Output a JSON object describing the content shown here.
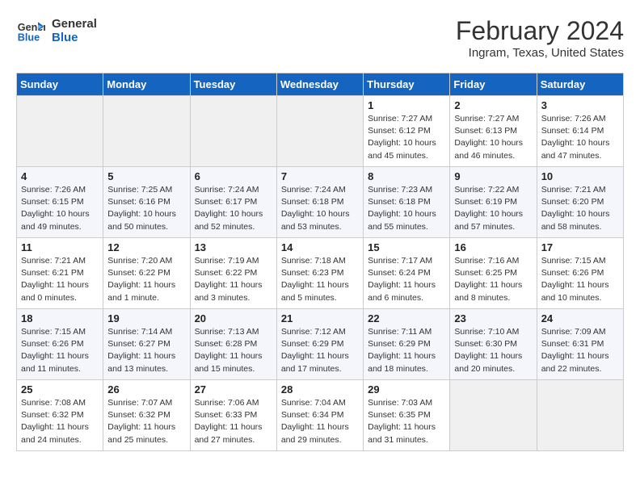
{
  "logo": {
    "line1": "General",
    "line2": "Blue"
  },
  "header": {
    "month": "February 2024",
    "location": "Ingram, Texas, United States"
  },
  "days_of_week": [
    "Sunday",
    "Monday",
    "Tuesday",
    "Wednesday",
    "Thursday",
    "Friday",
    "Saturday"
  ],
  "weeks": [
    [
      {
        "day": "",
        "sunrise": "",
        "sunset": "",
        "daylight": ""
      },
      {
        "day": "",
        "sunrise": "",
        "sunset": "",
        "daylight": ""
      },
      {
        "day": "",
        "sunrise": "",
        "sunset": "",
        "daylight": ""
      },
      {
        "day": "",
        "sunrise": "",
        "sunset": "",
        "daylight": ""
      },
      {
        "day": "1",
        "sunrise": "7:27 AM",
        "sunset": "6:12 PM",
        "daylight": "10 hours and 45 minutes."
      },
      {
        "day": "2",
        "sunrise": "7:27 AM",
        "sunset": "6:13 PM",
        "daylight": "10 hours and 46 minutes."
      },
      {
        "day": "3",
        "sunrise": "7:26 AM",
        "sunset": "6:14 PM",
        "daylight": "10 hours and 47 minutes."
      }
    ],
    [
      {
        "day": "4",
        "sunrise": "7:26 AM",
        "sunset": "6:15 PM",
        "daylight": "10 hours and 49 minutes."
      },
      {
        "day": "5",
        "sunrise": "7:25 AM",
        "sunset": "6:16 PM",
        "daylight": "10 hours and 50 minutes."
      },
      {
        "day": "6",
        "sunrise": "7:24 AM",
        "sunset": "6:17 PM",
        "daylight": "10 hours and 52 minutes."
      },
      {
        "day": "7",
        "sunrise": "7:24 AM",
        "sunset": "6:18 PM",
        "daylight": "10 hours and 53 minutes."
      },
      {
        "day": "8",
        "sunrise": "7:23 AM",
        "sunset": "6:18 PM",
        "daylight": "10 hours and 55 minutes."
      },
      {
        "day": "9",
        "sunrise": "7:22 AM",
        "sunset": "6:19 PM",
        "daylight": "10 hours and 57 minutes."
      },
      {
        "day": "10",
        "sunrise": "7:21 AM",
        "sunset": "6:20 PM",
        "daylight": "10 hours and 58 minutes."
      }
    ],
    [
      {
        "day": "11",
        "sunrise": "7:21 AM",
        "sunset": "6:21 PM",
        "daylight": "11 hours and 0 minutes."
      },
      {
        "day": "12",
        "sunrise": "7:20 AM",
        "sunset": "6:22 PM",
        "daylight": "11 hours and 1 minute."
      },
      {
        "day": "13",
        "sunrise": "7:19 AM",
        "sunset": "6:22 PM",
        "daylight": "11 hours and 3 minutes."
      },
      {
        "day": "14",
        "sunrise": "7:18 AM",
        "sunset": "6:23 PM",
        "daylight": "11 hours and 5 minutes."
      },
      {
        "day": "15",
        "sunrise": "7:17 AM",
        "sunset": "6:24 PM",
        "daylight": "11 hours and 6 minutes."
      },
      {
        "day": "16",
        "sunrise": "7:16 AM",
        "sunset": "6:25 PM",
        "daylight": "11 hours and 8 minutes."
      },
      {
        "day": "17",
        "sunrise": "7:15 AM",
        "sunset": "6:26 PM",
        "daylight": "11 hours and 10 minutes."
      }
    ],
    [
      {
        "day": "18",
        "sunrise": "7:15 AM",
        "sunset": "6:26 PM",
        "daylight": "11 hours and 11 minutes."
      },
      {
        "day": "19",
        "sunrise": "7:14 AM",
        "sunset": "6:27 PM",
        "daylight": "11 hours and 13 minutes."
      },
      {
        "day": "20",
        "sunrise": "7:13 AM",
        "sunset": "6:28 PM",
        "daylight": "11 hours and 15 minutes."
      },
      {
        "day": "21",
        "sunrise": "7:12 AM",
        "sunset": "6:29 PM",
        "daylight": "11 hours and 17 minutes."
      },
      {
        "day": "22",
        "sunrise": "7:11 AM",
        "sunset": "6:29 PM",
        "daylight": "11 hours and 18 minutes."
      },
      {
        "day": "23",
        "sunrise": "7:10 AM",
        "sunset": "6:30 PM",
        "daylight": "11 hours and 20 minutes."
      },
      {
        "day": "24",
        "sunrise": "7:09 AM",
        "sunset": "6:31 PM",
        "daylight": "11 hours and 22 minutes."
      }
    ],
    [
      {
        "day": "25",
        "sunrise": "7:08 AM",
        "sunset": "6:32 PM",
        "daylight": "11 hours and 24 minutes."
      },
      {
        "day": "26",
        "sunrise": "7:07 AM",
        "sunset": "6:32 PM",
        "daylight": "11 hours and 25 minutes."
      },
      {
        "day": "27",
        "sunrise": "7:06 AM",
        "sunset": "6:33 PM",
        "daylight": "11 hours and 27 minutes."
      },
      {
        "day": "28",
        "sunrise": "7:04 AM",
        "sunset": "6:34 PM",
        "daylight": "11 hours and 29 minutes."
      },
      {
        "day": "29",
        "sunrise": "7:03 AM",
        "sunset": "6:35 PM",
        "daylight": "11 hours and 31 minutes."
      },
      {
        "day": "",
        "sunrise": "",
        "sunset": "",
        "daylight": ""
      },
      {
        "day": "",
        "sunrise": "",
        "sunset": "",
        "daylight": ""
      }
    ]
  ]
}
